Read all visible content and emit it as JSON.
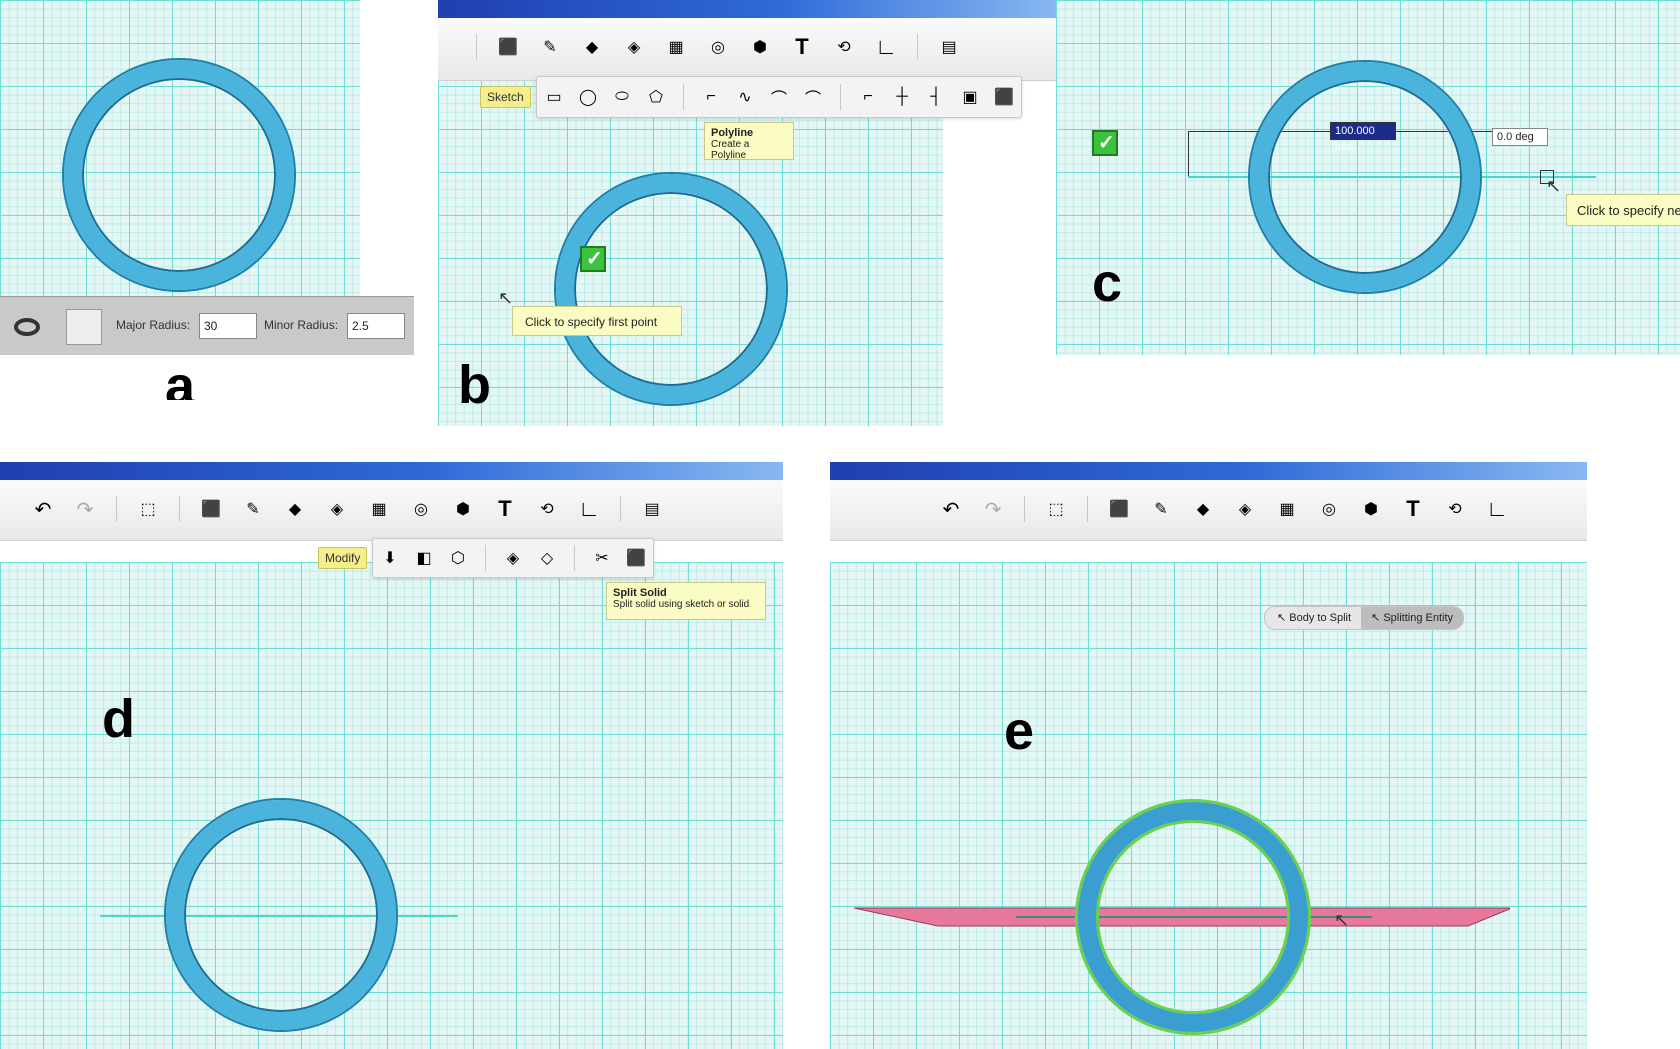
{
  "panels": {
    "a": {
      "letter": "a",
      "fields": {
        "major_label": "Major Radius:",
        "major_value": "30",
        "minor_label": "Minor Radius:",
        "minor_value": "2.5"
      }
    },
    "b": {
      "letter": "b",
      "sketch_tag": "Sketch",
      "tooltip_title": "Polyline",
      "tooltip_desc": "Create a Polyline",
      "hint": "Click to specify first point"
    },
    "c": {
      "letter": "c",
      "length_value": "100.000 mm",
      "angle_value": "0.0 deg",
      "hint": "Click to specify ne"
    },
    "d": {
      "letter": "d",
      "modify_tag": "Modify",
      "tooltip_title": "Split Solid",
      "tooltip_desc": "Split solid using sketch or solid"
    },
    "e": {
      "letter": "e",
      "body_to_split": "Body to Split",
      "splitting_entity": "Splitting Entity"
    }
  },
  "colors": {
    "grid_bg": "#e4f7f5",
    "ring": "#4bb4dc",
    "titlebar": "#2f6ad8",
    "split_plane": "#e8789c",
    "selection": "#6ad24a"
  },
  "toolbar_icons": [
    "primitives-icon",
    "sketch-icon",
    "construct-icon",
    "modify-icon",
    "pattern-icon",
    "grouping-icon",
    "combine-icon",
    "text-icon",
    "snap-icon",
    "measure-icon",
    "material-icon"
  ]
}
